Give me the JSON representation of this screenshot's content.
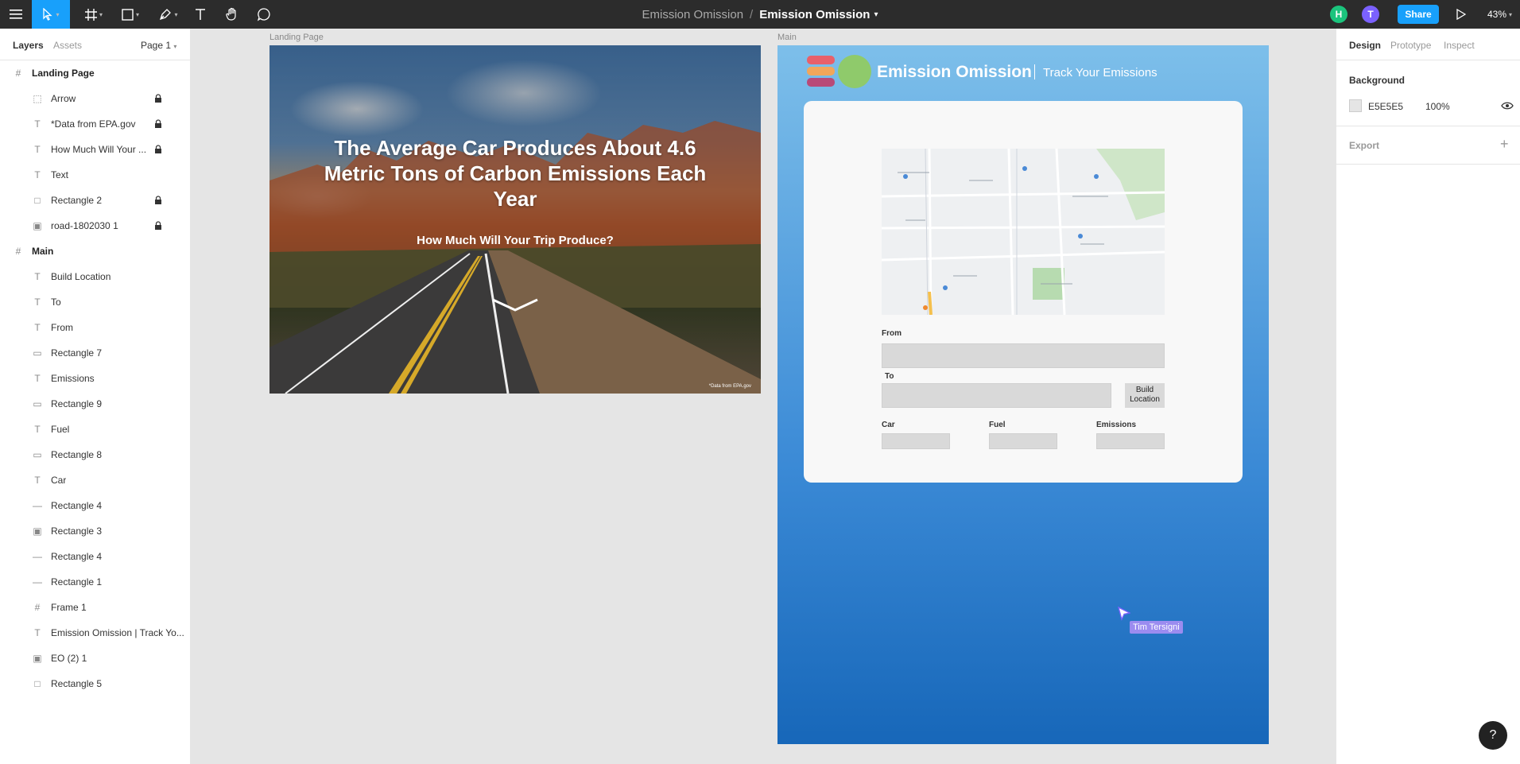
{
  "toolbar": {
    "project_name": "Emission Omission",
    "separator": "/",
    "file_name": "Emission Omission",
    "share_label": "Share",
    "zoom": "43%",
    "avatars": [
      {
        "initial": "H",
        "color": "#1bc47d"
      },
      {
        "initial": "T",
        "color": "#7b61ff"
      }
    ]
  },
  "left_panel": {
    "tabs": [
      "Layers",
      "Assets"
    ],
    "page_selector": "Page 1",
    "layers": [
      {
        "name": "Landing Page",
        "kind": "frame",
        "locked": false
      },
      {
        "name": "Arrow",
        "kind": "group",
        "locked": true
      },
      {
        "name": "*Data from EPA.gov",
        "kind": "text",
        "locked": true
      },
      {
        "name": "How Much Will Your ...",
        "kind": "text",
        "locked": true
      },
      {
        "name": "Text",
        "kind": "text",
        "locked": false
      },
      {
        "name": "Rectangle 2",
        "kind": "rect",
        "locked": true
      },
      {
        "name": "road-1802030 1",
        "kind": "image",
        "locked": true
      },
      {
        "name": "Main",
        "kind": "frame",
        "locked": false
      },
      {
        "name": "Build Location",
        "kind": "text",
        "locked": false
      },
      {
        "name": "To",
        "kind": "text",
        "locked": false
      },
      {
        "name": "From",
        "kind": "text",
        "locked": false
      },
      {
        "name": "Rectangle 7",
        "kind": "rect-thin",
        "locked": false
      },
      {
        "name": "Emissions",
        "kind": "text",
        "locked": false
      },
      {
        "name": "Rectangle 9",
        "kind": "rect-thin",
        "locked": false
      },
      {
        "name": "Fuel",
        "kind": "text",
        "locked": false
      },
      {
        "name": "Rectangle 8",
        "kind": "rect-thin",
        "locked": false
      },
      {
        "name": "Car",
        "kind": "text",
        "locked": false
      },
      {
        "name": "Rectangle 4",
        "kind": "line",
        "locked": false
      },
      {
        "name": "Rectangle 3",
        "kind": "image",
        "locked": false
      },
      {
        "name": "Rectangle 4",
        "kind": "line",
        "locked": false
      },
      {
        "name": "Rectangle 1",
        "kind": "line",
        "locked": false
      },
      {
        "name": "Frame 1",
        "kind": "frame-child",
        "locked": false
      },
      {
        "name": "Emission Omission | Track Yo...",
        "kind": "text",
        "locked": false
      },
      {
        "name": "EO (2) 1",
        "kind": "image",
        "locked": false
      },
      {
        "name": "Rectangle 5",
        "kind": "rect",
        "locked": false
      }
    ]
  },
  "right_panel": {
    "tabs": [
      "Design",
      "Prototype",
      "Inspect"
    ],
    "background_title": "Background",
    "background_hex": "E5E5E5",
    "background_opacity": "100%",
    "background_color": "#e5e5e5",
    "export_title": "Export",
    "help": "?"
  },
  "canvas": {
    "landing_label": "Landing Page",
    "main_label": "Main",
    "landing": {
      "title": "The Average Car Produces About 4.6 Metric Tons of Carbon Emissions Each Year",
      "subtitle": "How Much Will Your Trip Produce?",
      "footnote": "*Data from EPA.gov"
    },
    "main": {
      "brand": "Emission Omission",
      "tagline": "Track Your Emissions",
      "logo_colors": [
        "#e8606a",
        "#f2a65a",
        "#b84a78"
      ],
      "from_label": "From",
      "to_label": "To",
      "build_label": "Build Location",
      "car_label": "Car",
      "fuel_label": "Fuel",
      "emissions_label": "Emissions"
    },
    "cursor_user": "Tim Tersigni"
  }
}
